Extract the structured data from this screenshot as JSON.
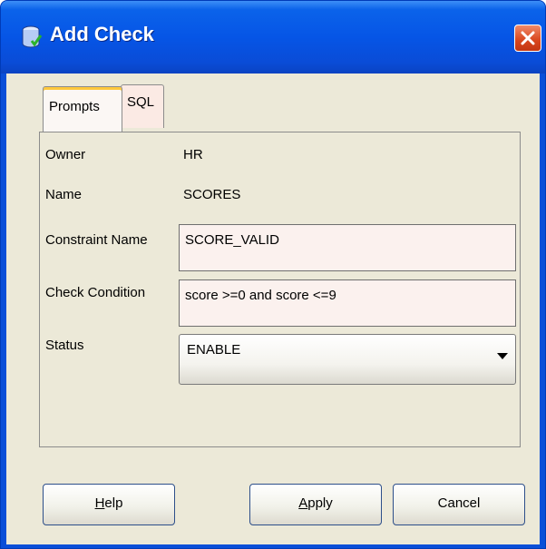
{
  "window": {
    "title": "Add Check"
  },
  "tabs": [
    {
      "label": "Prompts",
      "selected": true
    },
    {
      "label": "SQL",
      "selected": false
    }
  ],
  "form": {
    "owner": {
      "label": "Owner",
      "value": "HR"
    },
    "name": {
      "label": "Name",
      "value": "SCORES"
    },
    "constraint_name": {
      "label": "Constraint Name",
      "value": "SCORE_VALID"
    },
    "check_condition": {
      "label": "Check Condition",
      "value": "score >=0 and score <=9"
    },
    "status": {
      "label": "Status",
      "value": "ENABLE"
    }
  },
  "buttons": {
    "help": {
      "mnemonic": "H",
      "rest": "elp"
    },
    "apply": {
      "mnemonic": "A",
      "rest": "pply"
    },
    "cancel": {
      "label": "Cancel"
    }
  },
  "colors": {
    "titlebar": "#0655e6",
    "client": "#ece9d8",
    "field_bg": "#fbf1ee",
    "close_button": "#d8451c"
  },
  "icons": {
    "title": "database-check-icon",
    "close": "close-icon",
    "status_dropdown": "chevron-down-icon"
  }
}
